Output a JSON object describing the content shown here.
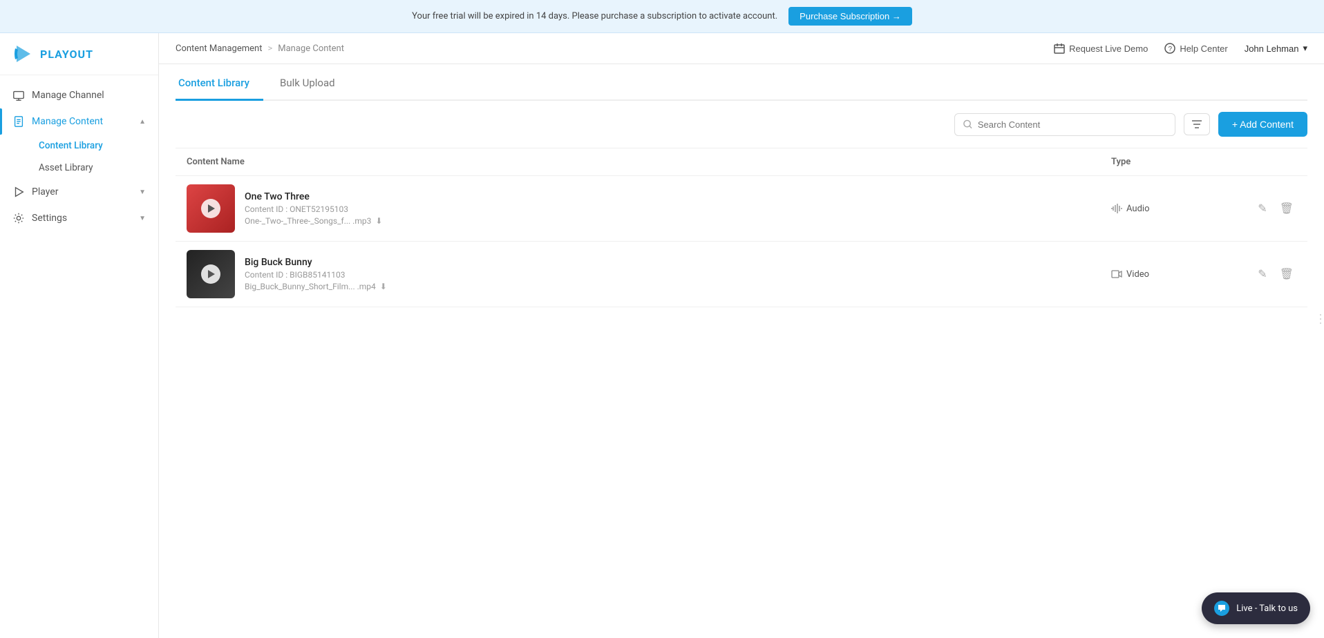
{
  "trial_banner": {
    "message": "Your free trial will be expired in 14 days. Please purchase a subscription to activate account.",
    "button_label": "Purchase Subscription →"
  },
  "logo": {
    "text": "PLAYOUT"
  },
  "sidebar": {
    "items": [
      {
        "id": "manage-channel",
        "label": "Manage Channel",
        "icon": "tv-icon",
        "has_chevron": false
      },
      {
        "id": "manage-content",
        "label": "Manage Content",
        "icon": "file-icon",
        "has_chevron": true,
        "active": true
      },
      {
        "id": "player",
        "label": "Player",
        "icon": "play-icon",
        "has_chevron": true
      },
      {
        "id": "settings",
        "label": "Settings",
        "icon": "gear-icon",
        "has_chevron": true
      }
    ],
    "sub_items": [
      {
        "id": "content-library",
        "label": "Content Library",
        "active": true
      },
      {
        "id": "asset-library",
        "label": "Asset Library",
        "active": false
      }
    ]
  },
  "header": {
    "breadcrumb": {
      "parent": "Content Management",
      "separator": ">",
      "current": "Manage Content"
    },
    "actions": [
      {
        "id": "request-demo",
        "label": "Request Live Demo",
        "icon": "calendar-icon"
      },
      {
        "id": "help-center",
        "label": "Help Center",
        "icon": "help-icon"
      }
    ],
    "user": {
      "name": "John Lehman",
      "chevron": "▾"
    }
  },
  "page": {
    "tabs": [
      {
        "id": "content-library",
        "label": "Content Library",
        "active": true
      },
      {
        "id": "bulk-upload",
        "label": "Bulk Upload",
        "active": false
      }
    ],
    "toolbar": {
      "search_placeholder": "Search Content",
      "filter_label": "Filter",
      "add_button_label": "+ Add Content"
    },
    "table": {
      "columns": [
        {
          "id": "content-name",
          "label": "Content Name"
        },
        {
          "id": "type",
          "label": "Type"
        }
      ],
      "rows": [
        {
          "id": "row-1",
          "title": "One Two Three",
          "content_id": "Content ID : ONET52195103",
          "filename": "One-_Two-_Three-_Songs_f... .mp3",
          "type": "Audio",
          "type_icon": "audio-icon",
          "thumbnail_style": "audio"
        },
        {
          "id": "row-2",
          "title": "Big Buck Bunny",
          "content_id": "Content ID : BIGB85141103",
          "filename": "Big_Buck_Bunny_Short_Film... .mp4",
          "type": "Video",
          "type_icon": "video-icon",
          "thumbnail_style": "video"
        }
      ]
    }
  },
  "live_chat": {
    "label": "Live - Talk to us"
  }
}
